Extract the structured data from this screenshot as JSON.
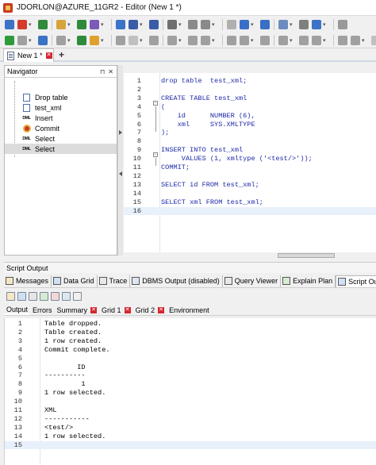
{
  "window": {
    "title": "JDORLON@AZURE_11GR2 - Editor (New 1 *)"
  },
  "colors": {
    "accent": "#1e2aa8",
    "close_red": "#d4272e",
    "current_line": "#e8f0fb"
  },
  "toolbar_row1": [
    {
      "icon": "window-icon",
      "color": "#3b73c6"
    },
    {
      "icon": "connect-icon",
      "color": "#d43a2e"
    },
    {
      "icon": "sql-icon",
      "color": "#2f8a3b"
    },
    {
      "icon": "open-folder-icon",
      "color": "#d6a43a"
    },
    {
      "icon": "run-icon",
      "color": "#2f8a3b"
    },
    {
      "icon": "edit-icon",
      "color": "#7a5cb8"
    },
    {
      "icon": "grid-icon",
      "color": "#3b73c6"
    },
    {
      "icon": "save-icon",
      "color": "#3a5ca8"
    },
    {
      "icon": "save-all-icon",
      "color": "#3a5ca8"
    },
    {
      "icon": "print-icon",
      "color": "#6f6f6f"
    },
    {
      "icon": "cut-icon",
      "color": "#8a8a8a"
    },
    {
      "icon": "copy-icon",
      "color": "#8a8a8a"
    },
    {
      "icon": "paste-icon",
      "color": "#b0b0b0"
    },
    {
      "icon": "undo-icon",
      "color": "#3a6fc6"
    },
    {
      "icon": "redo-icon",
      "color": "#3a6fc6"
    },
    {
      "icon": "find-icon",
      "color": "#6c8bbf"
    },
    {
      "icon": "settings-icon",
      "color": "#7f7f7f"
    },
    {
      "icon": "help-icon",
      "color": "#3b73c6"
    },
    {
      "icon": "options-icon",
      "color": "#999999"
    }
  ],
  "toolbar_row2": [
    {
      "icon": "execute-icon",
      "color": "#2f9a3b"
    },
    {
      "icon": "execute-script-icon",
      "color": "#a0a0a0"
    },
    {
      "icon": "explain-icon",
      "color": "#3b73c6"
    },
    {
      "icon": "trace-icon",
      "color": "#a0a0a0"
    },
    {
      "icon": "autotrace-icon",
      "color": "#2f8a3b"
    },
    {
      "icon": "commit-icon",
      "color": "#e0a030"
    },
    {
      "icon": "rollback-icon",
      "color": "#a0a0a0"
    },
    {
      "icon": "stop-icon",
      "color": "#c0c0c0"
    },
    {
      "icon": "format-icon",
      "color": "#a0a0a0"
    },
    {
      "icon": "comment-icon",
      "color": "#a0a0a0"
    },
    {
      "icon": "uncomment-icon",
      "color": "#a0a0a0"
    },
    {
      "icon": "indent-icon",
      "color": "#a0a0a0"
    },
    {
      "icon": "outdent-icon",
      "color": "#a0a0a0"
    },
    {
      "icon": "case-icon",
      "color": "#a0a0a0"
    },
    {
      "icon": "history-icon",
      "color": "#a0a0a0"
    },
    {
      "icon": "favorites-icon",
      "color": "#a0a0a0"
    },
    {
      "icon": "refresh-icon",
      "color": "#a0a0a0"
    },
    {
      "icon": "clear-icon",
      "color": "#a0a0a0"
    },
    {
      "icon": "back-icon",
      "color": "#a0a0a0"
    },
    {
      "icon": "forward-icon",
      "color": "#a0a0a0"
    },
    {
      "icon": "block-icon",
      "color": "#c0c0c0"
    }
  ],
  "doc_tabs": [
    {
      "label": "New 1 *"
    }
  ],
  "navigator": {
    "title": "Navigator",
    "items": [
      {
        "label": "Drop table",
        "icon": "document-icon",
        "kind": "doc"
      },
      {
        "label": "test_xml",
        "icon": "document-icon",
        "kind": "doc"
      },
      {
        "label": "Insert",
        "icon": "dml-icon",
        "kind": "dml",
        "badge": "DML"
      },
      {
        "label": "Commit",
        "icon": "commit-icon",
        "kind": "commit"
      },
      {
        "label": "Select",
        "icon": "dml-icon",
        "kind": "dml",
        "badge": "DML"
      },
      {
        "label": "Select",
        "icon": "dml-icon",
        "kind": "dml",
        "badge": "DML",
        "selected": true
      }
    ]
  },
  "editor": {
    "current_line": 16,
    "lines": [
      [
        {
          "t": "drop table  test_xml;",
          "c": "kw"
        }
      ],
      [],
      [
        {
          "t": "CREATE TABLE test_xml",
          "c": "kw"
        }
      ],
      [
        {
          "t": "(",
          "c": "kw"
        }
      ],
      [
        {
          "t": "    id      ",
          "c": "kw"
        },
        {
          "t": "NUMBER (6),",
          "c": "str"
        }
      ],
      [
        {
          "t": "    xml     ",
          "c": "kw"
        },
        {
          "t": "SYS.XMLTYPE",
          "c": "str"
        }
      ],
      [
        {
          "t": ");",
          "c": "kw"
        }
      ],
      [],
      [
        {
          "t": "INSERT INTO test_xml",
          "c": "kw"
        }
      ],
      [
        {
          "t": "     VALUES (1, xmltype ('<test/>'));",
          "c": "kw"
        }
      ],
      [
        {
          "t": "COMMIT;",
          "c": "kw"
        }
      ],
      [],
      [
        {
          "t": "SELECT id FROM test_xml;",
          "c": "kw"
        }
      ],
      [],
      [
        {
          "t": "SELECT xml FROM test_xml;",
          "c": "kw"
        }
      ],
      []
    ]
  },
  "script_output": {
    "title": "Script Output",
    "content_tabs": [
      {
        "label": "Messages",
        "icon": "messages-icon"
      },
      {
        "label": "Data Grid",
        "icon": "data-grid-icon"
      },
      {
        "label": "Trace",
        "icon": "trace-icon"
      },
      {
        "label": "DBMS Output (disabled)",
        "icon": "dbms-output-icon"
      },
      {
        "label": "Query Viewer",
        "icon": "query-viewer-icon"
      },
      {
        "label": "Explain Plan",
        "icon": "explain-plan-icon"
      },
      {
        "label": "Script Output",
        "icon": "script-output-icon",
        "active": true
      }
    ],
    "sub_tabs": [
      {
        "label": "Output",
        "active": true,
        "closable": false
      },
      {
        "label": "Errors",
        "closable": false
      },
      {
        "label": "Summary",
        "closable": true
      },
      {
        "label": "Grid 1",
        "closable": true
      },
      {
        "label": "Grid 2",
        "closable": true
      },
      {
        "label": "Environment",
        "closable": false
      }
    ],
    "current_line": 15,
    "lines": [
      "Table dropped.",
      "Table created.",
      "1 row created.",
      "Commit complete.",
      "",
      "        ID",
      "----------",
      "         1",
      "1 row selected.",
      "",
      "XML",
      "-----------",
      "<test/>",
      "1 row selected.",
      ""
    ]
  }
}
